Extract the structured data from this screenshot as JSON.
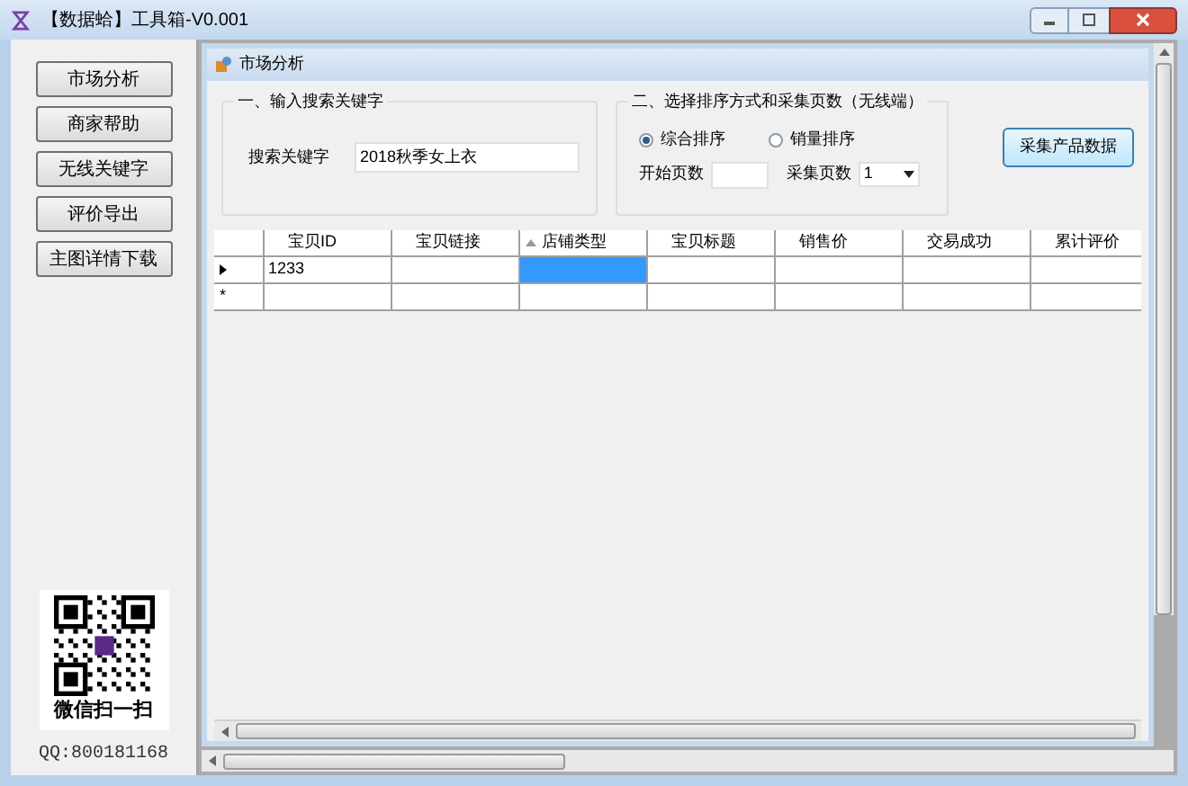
{
  "window": {
    "title": "【数据蛤】工具箱-V0.001"
  },
  "sidebar": {
    "buttons": [
      "市场分析",
      "商家帮助",
      "无线关键字",
      "评价导出",
      "主图详情下载"
    ],
    "qr_caption": "微信扫一扫",
    "qq": "QQ:800181168"
  },
  "child_window": {
    "title": "市场分析"
  },
  "keyword_group": {
    "title": "一、输入搜索关键字",
    "label": "搜索关键字",
    "value": "2018秋季女上衣"
  },
  "sort_group": {
    "title": "二、选择排序方式和采集页数（无线端）",
    "options": [
      {
        "label": "综合排序",
        "selected": true
      },
      {
        "label": "销量排序",
        "selected": false
      }
    ],
    "start_label": "开始页数",
    "pages_label": "采集页数",
    "pages_value": "1"
  },
  "collect_button": "采集产品数据",
  "table": {
    "columns": [
      {
        "label": "宝贝ID",
        "sorted": false
      },
      {
        "label": "宝贝链接",
        "sorted": false
      },
      {
        "label": "店铺类型",
        "sorted": true
      },
      {
        "label": "宝贝标题",
        "sorted": false
      },
      {
        "label": "销售价",
        "sorted": false
      },
      {
        "label": "交易成功",
        "sorted": false
      },
      {
        "label": "累计评价",
        "sorted": false
      }
    ],
    "rows": [
      {
        "kind": "current",
        "cells": [
          {
            "text": "1233",
            "selected": false
          },
          {
            "selected": false
          },
          {
            "selected": true
          },
          {
            "selected": false
          },
          {
            "selected": false
          },
          {
            "selected": false
          },
          {
            "selected": false
          }
        ]
      },
      {
        "kind": "new",
        "marker": "*",
        "cells": [
          {
            "selected": false
          },
          {
            "selected": false
          },
          {
            "selected": false
          },
          {
            "selected": false
          },
          {
            "selected": false
          },
          {
            "selected": false
          },
          {
            "selected": false
          }
        ]
      }
    ]
  }
}
